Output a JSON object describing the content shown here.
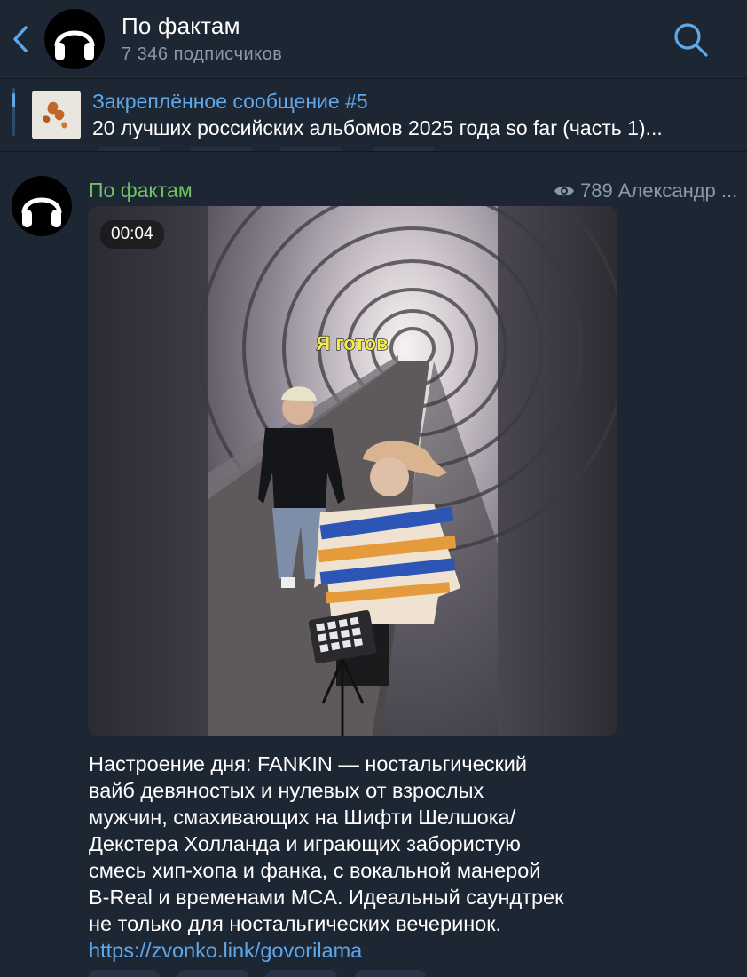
{
  "header": {
    "title": "По фактам",
    "subscribers": "7 346 подписчиков"
  },
  "pinned": {
    "title": "Закреплённое сообщение #5",
    "text": "20 лучших российских альбомов 2025 года so far (часть 1)..."
  },
  "post": {
    "author": "По фактам",
    "views": "789",
    "signature": "Александр ...",
    "video_duration": "00:04",
    "video_caption": "Я готов",
    "text_lines": [
      "Настроение дня: FANKIN — ностальгический",
      "вайб девяностых и нулевых от взрослых",
      "мужчин, смахивающих на Шифти Шелшока/",
      "Декстера Холланда и играющих забористую",
      "смесь хип-хопа и фанка, с вокальной манерой",
      "B-Real и временами MCA. Идеальный саундтрек",
      "не только для ностальгических вечеринок."
    ],
    "link": "https://zvonko.link/govorilama"
  },
  "icons": {
    "back": "chevron-left-icon",
    "search": "search-icon",
    "views": "eye-icon",
    "avatar": "headphones-icon"
  },
  "colors": {
    "background": "#1d2633",
    "accent": "#5ea8ea",
    "author": "#6dc264",
    "muted": "#8d99a8"
  }
}
